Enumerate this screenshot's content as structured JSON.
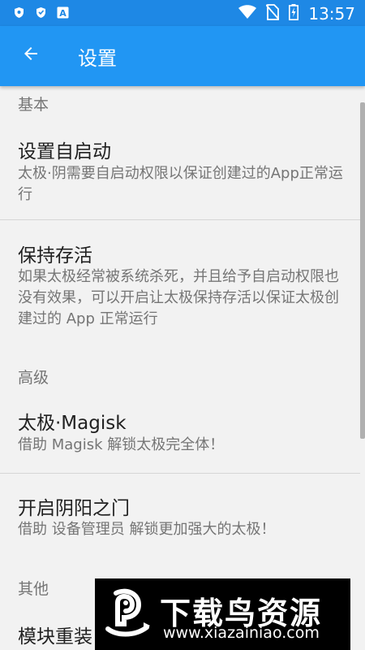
{
  "status_bar": {
    "left_icons": [
      "shield-icon",
      "shield-icon",
      "a-box-icon"
    ],
    "a_box_label": "A",
    "right_icons": [
      "wifi-icon",
      "no-sim-icon",
      "battery-charging-icon"
    ],
    "time": "13:57"
  },
  "app_bar": {
    "title": "设置",
    "back_icon": "arrow-back-icon",
    "background": "#2196f3"
  },
  "sections": {
    "basic": {
      "header": "基本",
      "items": [
        {
          "title": "设置自启动",
          "summary": "太极·阴需要自启动权限以保证创建过的App正常运行"
        },
        {
          "title": "保持存活",
          "summary": "如果太极经常被系统杀死，并且给予自启动权限也没有效果，可以开启让太极保持存活以保证太极创建过的 App 正常运行"
        }
      ]
    },
    "advanced": {
      "header": "高级",
      "items": [
        {
          "title": "太极·Magisk",
          "summary": "借助 Magisk 解锁太极完全体！"
        },
        {
          "title": "开启阴阳之门",
          "summary": "借助 设备管理员 解锁更加强大的太极！"
        }
      ]
    },
    "other": {
      "header": "其他",
      "items": [
        {
          "title": "模块重装",
          "summary": "",
          "toggle_on": false
        }
      ]
    }
  },
  "watermark": {
    "title": "下载鸟资源",
    "url": "www.xiazainiao.com"
  }
}
